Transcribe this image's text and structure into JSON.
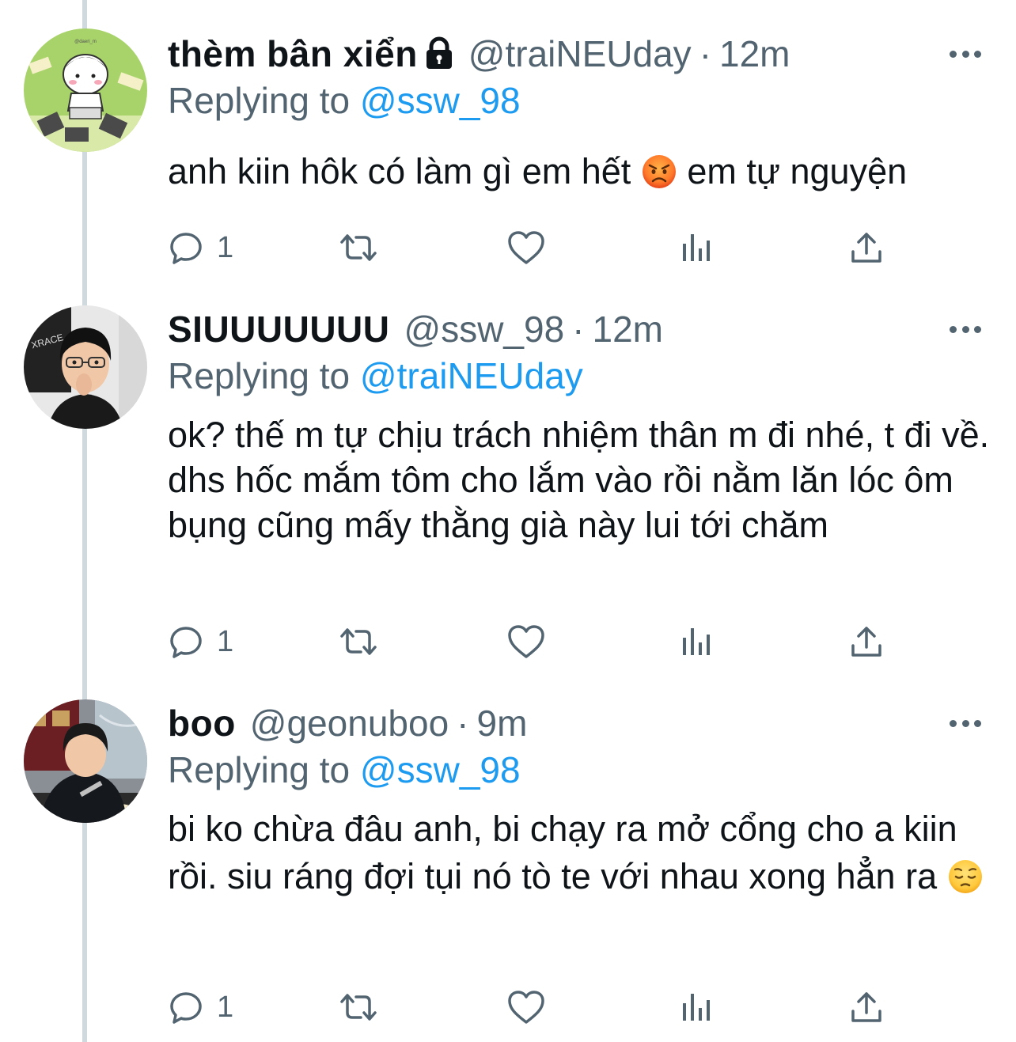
{
  "tweets": [
    {
      "name": "thèm bân xiển",
      "protected": true,
      "handle": "@traiNEUday",
      "separator": "·",
      "time": "12m",
      "replying_prefix": "Replying to",
      "replying_to": "@ssw_98",
      "text_before_emoji": "anh kiin hôk có làm gì em hết",
      "emoji": "pouting-face",
      "text_after_emoji": " em tự nguyện",
      "reply_count": "1",
      "avatar": "cartoon-boy-avatar"
    },
    {
      "name": "SIUUUUUUU",
      "protected": false,
      "handle": "@ssw_98",
      "separator": "·",
      "time": "12m",
      "replying_prefix": "Replying to",
      "replying_to": "@traiNEUday",
      "text": "ok? thế m tự chịu trách nhiệm thân m đi nhé, t đi về. dhs hốc mắm tôm cho lắm vào rồi nằm lăn lóc ôm bụng cũng mấy thằng già này lui tới chăm",
      "reply_count": "1",
      "avatar": "gamer-photo-avatar"
    },
    {
      "name": "boo",
      "protected": false,
      "handle": "@geonuboo",
      "separator": "·",
      "time": "9m",
      "replying_prefix": "Replying to",
      "replying_to": "@ssw_98",
      "text_before_emoji": "bi ko chừa đâu anh, bi chạy ra mở cổng cho a kiin rồi. siu ráng đợi tụi nó tò te với nhau xong hẳn ra",
      "emoji": "pensive-face",
      "reply_count": "1",
      "avatar": "eating-photo-avatar"
    }
  ],
  "colors": {
    "text": "#0f1419",
    "secondary": "#536471",
    "link": "#1d9bf0",
    "thread_line": "#cfd9de"
  }
}
